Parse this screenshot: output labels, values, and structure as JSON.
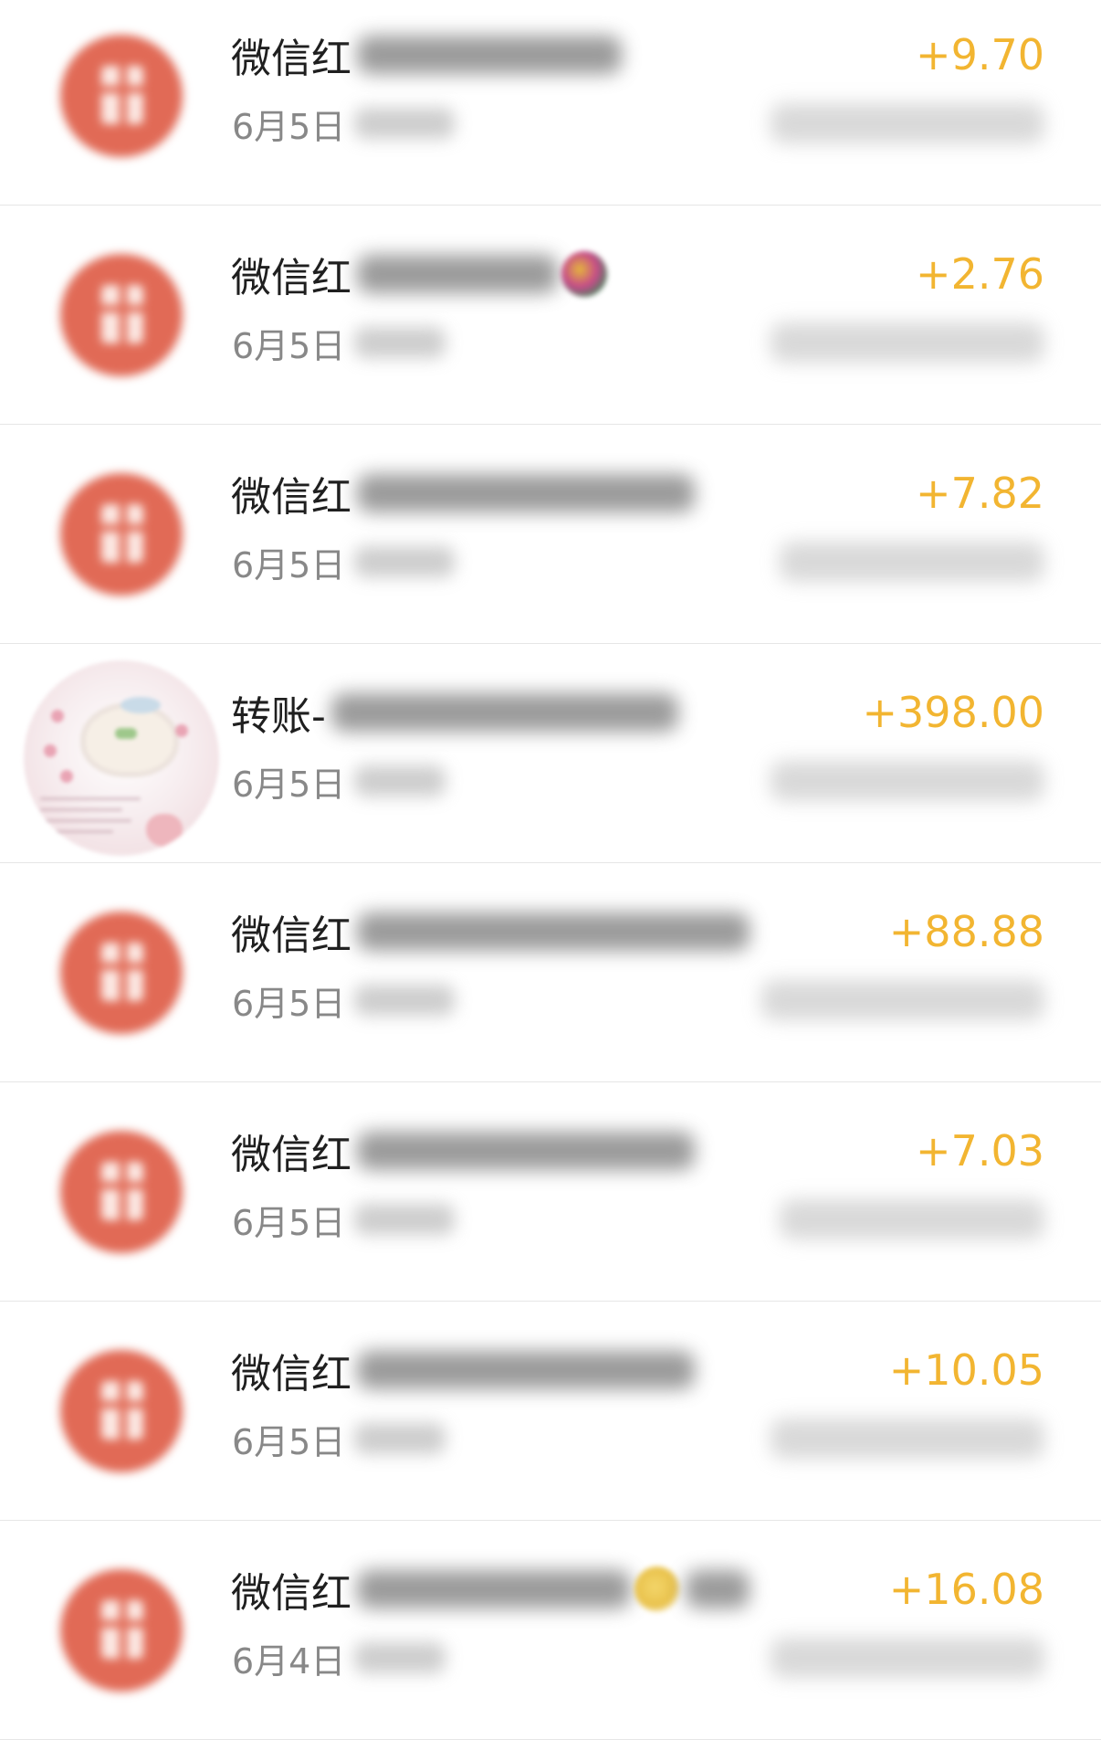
{
  "transactions": [
    {
      "title": "微信红",
      "date": "6月5日",
      "amount": "+9.70",
      "avatar": "red-packet-icon"
    },
    {
      "title": "微信红",
      "date": "6月5日",
      "amount": "+2.76",
      "avatar": "red-packet-icon"
    },
    {
      "title": "微信红",
      "date": "6月5日",
      "amount": "+7.82",
      "avatar": "red-packet-icon"
    },
    {
      "title": "转账-",
      "date": "6月5日",
      "amount": "+398.00",
      "avatar": "user-avatar"
    },
    {
      "title": "微信红",
      "date": "6月5日",
      "amount": "+88.88",
      "avatar": "red-packet-icon"
    },
    {
      "title": "微信红",
      "date": "6月5日",
      "amount": "+7.03",
      "avatar": "red-packet-icon"
    },
    {
      "title": "微信红",
      "date": "6月5日",
      "amount": "+10.05",
      "avatar": "red-packet-icon"
    },
    {
      "title": "微信红",
      "date": "6月4日",
      "amount": "+16.08",
      "avatar": "red-packet-icon"
    }
  ],
  "colors": {
    "amount": "#f2b531",
    "red_packet": "#e16a56",
    "divider": "#e6e6e6"
  }
}
